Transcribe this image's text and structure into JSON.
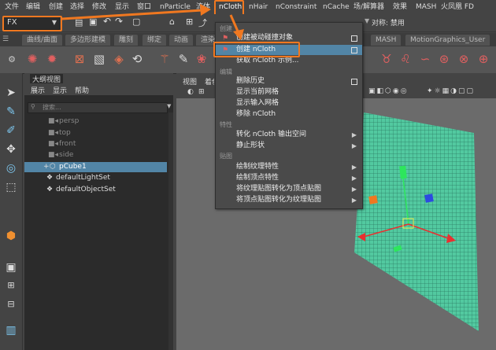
{
  "menubar": {
    "items": [
      "文件",
      "编辑",
      "创建",
      "选择",
      "修改",
      "显示",
      "窗口",
      "nParticle",
      "流体",
      "nCloth",
      "nHair",
      "nConstraint",
      "nCache",
      "场/解算器",
      "效果",
      "MASH",
      "火凤凰 FD"
    ]
  },
  "toolbar": {
    "mode_value": "FX",
    "symmetry_value": "对称: 禁用"
  },
  "shelf": {
    "tabs": [
      "曲线/曲面",
      "多边形建模",
      "雕刻",
      "绑定",
      "动画",
      "渲染",
      "MASH",
      "MotionGraphics_User"
    ]
  },
  "outliner": {
    "title": "大纲视图",
    "menu": [
      "展示",
      "显示",
      "帮助"
    ],
    "search_placeholder": "搜索...",
    "items": [
      {
        "label": "persp",
        "kind": "camera"
      },
      {
        "label": "top",
        "kind": "camera"
      },
      {
        "label": "front",
        "kind": "camera"
      },
      {
        "label": "side",
        "kind": "camera"
      },
      {
        "label": "pCube1",
        "kind": "mesh",
        "selected": true
      },
      {
        "label": "defaultLightSet",
        "kind": "set"
      },
      {
        "label": "defaultObjectSet",
        "kind": "set"
      }
    ]
  },
  "viewport": {
    "panel_menu": [
      "视图",
      "着色"
    ]
  },
  "popup": {
    "sections": {
      "create": "创建",
      "edit": "编辑",
      "properties": "特性",
      "maps": "贴图"
    },
    "items": {
      "create_passive": "创建被动碰撞对象",
      "create_ncloth": "创建 nCloth",
      "get_example": "获取 nCloth 示例...",
      "delete_history": "删除历史",
      "show_current_mesh": "显示当前网格",
      "show_input_mesh": "显示输入网格",
      "remove_ncloth": "移除 nCloth",
      "convert_output": "转化 nCloth 输出空间",
      "rest_shape": "静止形状",
      "paint_texture": "绘制纹理特性",
      "paint_vertex": "绘制顶点特性",
      "tex_to_vertex": "将纹理贴图转化为顶点贴图",
      "vertex_to_tex": "将顶点贴图转化为纹理贴图"
    }
  },
  "colors": {
    "highlight": "#f07820",
    "selection": "#5285a6",
    "mesh": "#52c9a0"
  }
}
